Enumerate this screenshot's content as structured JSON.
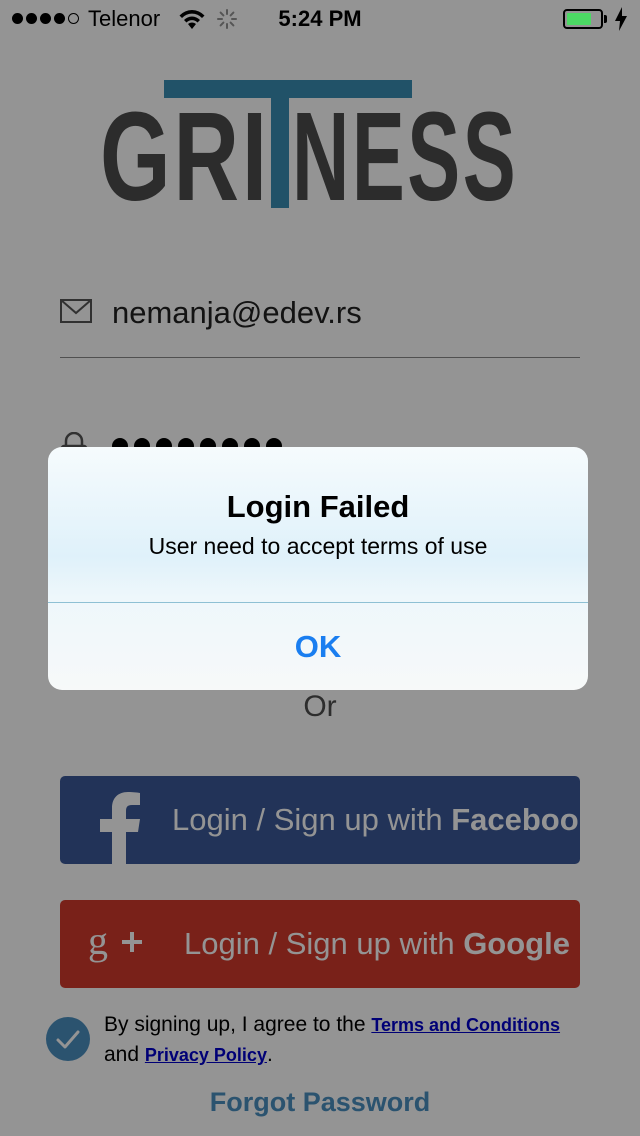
{
  "status_bar": {
    "carrier": "Telenor",
    "time": "5:24 PM",
    "signal_bars": 4,
    "signal_max": 5,
    "battery_level": 0.75,
    "battery_color": "#4cd964"
  },
  "logo": {
    "left_text": "GRI",
    "right_text": "NESS",
    "accent_color": "#3a8db3",
    "text_color": "#4c4c4c"
  },
  "login_form": {
    "email_value": "nemanja@edev.rs",
    "password_length": 8,
    "email_icon": "envelope-icon",
    "password_icon": "lock-icon"
  },
  "divider_text": "Or",
  "social": {
    "facebook": {
      "prefix": "Login / Sign up with ",
      "brand": "Facebook",
      "icon": "facebook-icon",
      "color": "#3b5998"
    },
    "google": {
      "prefix": "Login / Sign up with ",
      "brand": "Google",
      "icon": "google-plus-icon",
      "color": "#d0392b"
    }
  },
  "terms": {
    "accepted": true,
    "text_before": "By signing up, I agree to the ",
    "terms_link": "Terms and Conditions",
    "text_middle": "and ",
    "privacy_link": "Privacy Policy",
    "text_after": "."
  },
  "forgot_password": "Forgot Password",
  "alert": {
    "title": "Login Failed",
    "message": "User need to accept terms of use",
    "ok_label": "OK"
  }
}
